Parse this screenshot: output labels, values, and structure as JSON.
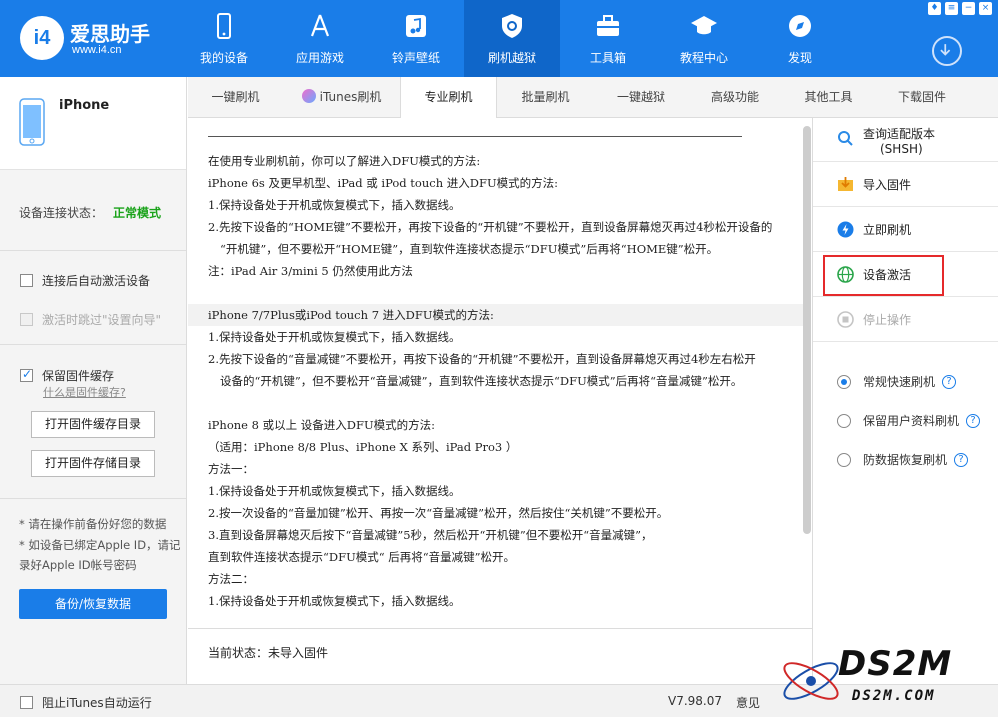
{
  "header": {
    "logo_name": "爱思助手",
    "logo_url": "www.i4.cn",
    "nav": [
      {
        "label": "我的设备",
        "icon": "phone-icon"
      },
      {
        "label": "应用游戏",
        "icon": "appstore-icon"
      },
      {
        "label": "铃声壁纸",
        "icon": "music-icon"
      },
      {
        "label": "刷机越狱",
        "icon": "shield-icon",
        "active": true
      },
      {
        "label": "工具箱",
        "icon": "toolbox-icon"
      },
      {
        "label": "教程中心",
        "icon": "graduation-cap-icon"
      },
      {
        "label": "发现",
        "icon": "compass-icon"
      }
    ],
    "accent": "#1a7de8"
  },
  "left": {
    "device_name": "iPhone",
    "conn_label": "设备连接状态：",
    "conn_value": "正常模式",
    "auto_activate": "连接后自动激活设备",
    "skip_wizard": "激活时跳过\"设置向导\"",
    "keep_cache": "保留固件缓存",
    "what_cache": "什么是固件缓存?",
    "open_cache_dir": "打开固件缓存目录",
    "open_store_dir": "打开固件存储目录",
    "note1": "* 请在操作前备份好您的数据",
    "note2": "* 如设备已绑定Apple ID，请记录好Apple ID帐号密码",
    "backup_btn": "备份/恢复数据"
  },
  "tabs": [
    "一键刷机",
    "iTunes刷机",
    "专业刷机",
    "批量刷机",
    "一键越狱",
    "高级功能",
    "其他工具",
    "下载固件"
  ],
  "content": {
    "lines": [
      "在使用专业刷机前，你可以了解进入DFU模式的方法:",
      "iPhone 6s 及更早机型、iPad 或 iPod touch 进入DFU模式的方法:",
      "1.保持设备处于开机或恢复模式下，插入数据线。",
      "2.先按下设备的“HOME键”不要松开，再按下设备的“开机键”不要松开，直到设备屏幕熄灭再过4秒松开设备的",
      "“开机键”，但不要松开“HOME键”，直到软件连接状态提示“DFU模式”后再将“HOME键”松开。",
      "注：iPad Air 3/mini 5 仍然使用此方法",
      "iPhone 7/7Plus或iPod touch 7 进入DFU模式的方法:",
      "1.保持设备处于开机或恢复模式下，插入数据线。",
      "2.先按下设备的“音量减键”不要松开，再按下设备的“开机键”不要松开，直到设备屏幕熄灭再过4秒左右松开",
      "设备的“开机键”，但不要松开“音量减键”，直到软件连接状态提示“DFU模式”后再将“音量减键”松开。",
      "iPhone 8 或以上 设备进入DFU模式的方法:",
      "（适用：iPhone 8/8 Plus、iPhone X 系列、iPad Pro3 ）",
      "方法一：",
      "1.保持设备处于开机或恢复模式下，插入数据线。",
      "2.按一次设备的“音量加键”松开、再按一次“音量减键”松开，然后按住“关机键”不要松开。",
      "3.直到设备屏幕熄灭后按下“音量减键”5秒，然后松开“开机键”但不要松开“音量减键”，",
      "直到软件连接状态提示“DFU模式“ 后再将“音量减键”松开。",
      "方法二：",
      "1.保持设备处于开机或恢复模式下，插入数据线。"
    ],
    "status": "当前状态：未导入固件"
  },
  "right": {
    "query": "查询适配版本",
    "query_sub": "(SHSH)",
    "import": "导入固件",
    "flash_now": "立即刷机",
    "activate": "设备激活",
    "stop": "停止操作",
    "modes": [
      "常规快速刷机",
      "保留用户资料刷机",
      "防数据恢复刷机"
    ],
    "help": "?"
  },
  "footer": {
    "block_itunes": "阻止iTunes自动运行",
    "version": "V7.98.07",
    "feedback": "意见"
  },
  "watermark": {
    "main": "DS2M",
    "sub": "DS2M.COM"
  }
}
